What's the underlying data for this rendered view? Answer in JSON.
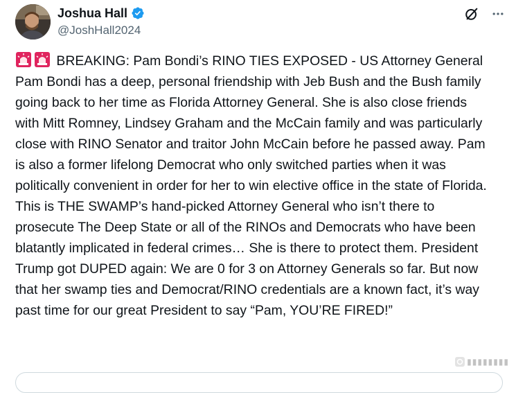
{
  "author": {
    "display_name": "Joshua Hall",
    "handle": "@JoshHall2024",
    "verified": true,
    "verified_color": "#1d9bf0"
  },
  "icons": {
    "siren": "police-car-light-emoji",
    "grok": "grok-icon",
    "more": "more-dots-icon"
  },
  "tweet": {
    "text": "BREAKING: Pam Bondi’s RINO TIES EXPOSED - US Attorney General Pam Bondi has a deep, personal friendship with Jeb Bush and the Bush family going back to her time as Florida Attorney General. She is also close friends with Mitt Romney, Lindsey Graham and the McCain family and was particularly close with RINO Senator and traitor John McCain before he passed away. Pam is also a former lifelong Democrat who only switched parties when it was politically convenient in order for her to win elective office in the state of Florida. This is THE SWAMP’s hand-picked Attorney General who isn’t there to prosecute The Deep State or all of the RINOs and Democrats who have been blatantly implicated in federal crimes… She is there to protect them. President Trump got DUPED again: We are 0 for 3 on Attorney Generals so far. But now that her swamp ties and Democrat/RINO credentials are a known fact, it’s way past time for our great President to say “Pam, YOU’RE FIRED!”"
  },
  "colors": {
    "text": "#0f1419",
    "secondary": "#536471",
    "siren_red": "#e0245e",
    "border": "#cfd9de"
  }
}
